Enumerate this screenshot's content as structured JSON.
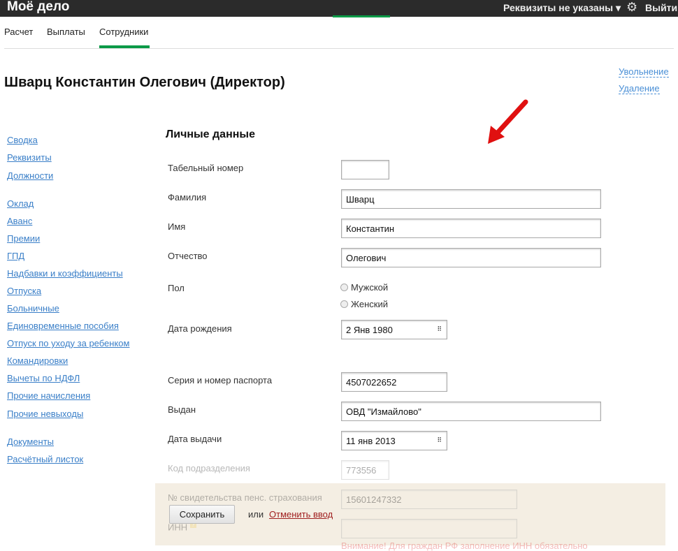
{
  "header": {
    "logo": "Моё дело",
    "requisites": "Реквизиты не указаны ▾",
    "exit": "Выйти"
  },
  "tabs": [
    "Расчет",
    "Выплаты",
    "Сотрудники"
  ],
  "title": "Шварц Константин Олегович (Директор)",
  "actions": [
    "Увольнение",
    "Удаление"
  ],
  "sidebar": [
    "Сводка",
    "Реквизиты",
    "Должности",
    "Оклад",
    "Аванс",
    "Премии",
    "ГПД",
    "Надбавки и коэффициенты",
    "Отпуска",
    "Больничные",
    "Единовременные пособия",
    "Отпуск по уходу за ребенком",
    "Командировки",
    "Вычеты по НДФЛ",
    "Прочие начисления",
    "Прочие невыходы",
    "Документы",
    "Расчётный листок"
  ],
  "section_title": "Личные данные",
  "fields": {
    "tab_number": {
      "label": "Табельный номер",
      "value": ""
    },
    "surname": {
      "label": "Фамилия",
      "value": "Шварц"
    },
    "name": {
      "label": "Имя",
      "value": "Константин"
    },
    "patronymic": {
      "label": "Отчество",
      "value": "Олегович"
    },
    "gender": {
      "label": "Пол",
      "options": [
        "Мужской",
        "Женский"
      ]
    },
    "birth": {
      "label": "Дата рождения",
      "value": "2 Янв 1980"
    },
    "passport": {
      "label": "Серия и номер паспорта",
      "value": "4507022652"
    },
    "issued": {
      "label": "Выдан",
      "value": "ОВД \"Измайлово\""
    },
    "issue_date": {
      "label": "Дата выдачи",
      "value": "11 янв 2013"
    },
    "dept_code": {
      "label": "Код подразделения",
      "value": "773556"
    },
    "snils": {
      "label": "№ свидетельства пенс. страхования",
      "value": "15601247332"
    },
    "inn": {
      "label": "ИНН",
      "value": "",
      "help": "?",
      "warning": "Внимание! Для граждан РФ заполнение ИНН обязательно"
    }
  },
  "footer": {
    "save": "Сохранить",
    "or": "или",
    "cancel": "Отменить ввод"
  },
  "colors": {
    "accent": "#0a9a47",
    "link": "#3a7fc8",
    "arrow": "#e01010"
  }
}
